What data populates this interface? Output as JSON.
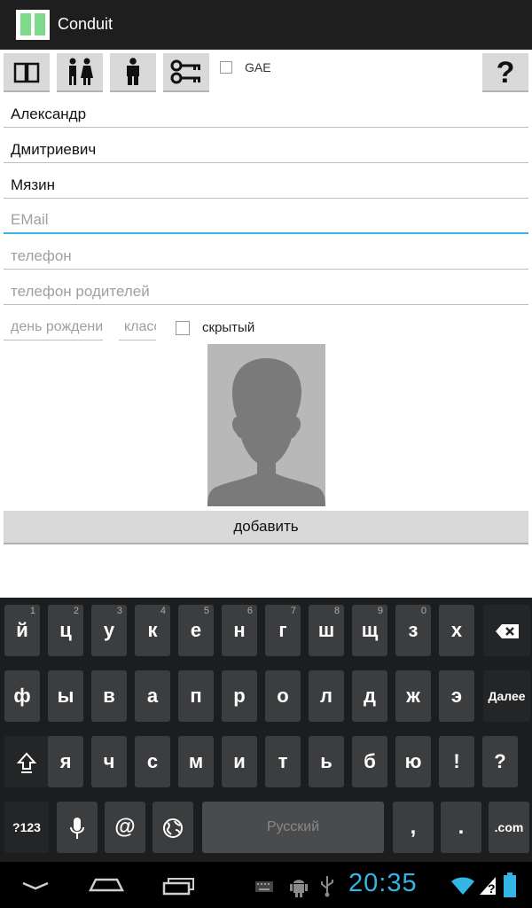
{
  "app": {
    "title": "Conduit"
  },
  "toolbar": {
    "gae_label": "GAE",
    "help_label": "?"
  },
  "form": {
    "first_name": "Александр",
    "middle_name": "Дмитриевич",
    "last_name": "Мязин",
    "email_placeholder": "EMail",
    "phone_placeholder": "телефон",
    "parent_phone_placeholder": "телефон родителей",
    "birthday_placeholder": "день рождения",
    "class_placeholder": "класс",
    "hidden_label": "скрытый",
    "add_button": "добавить"
  },
  "keyboard": {
    "row1": [
      {
        "label": "й",
        "hint": "1"
      },
      {
        "label": "ц",
        "hint": "2"
      },
      {
        "label": "у",
        "hint": "3"
      },
      {
        "label": "к",
        "hint": "4"
      },
      {
        "label": "е",
        "hint": "5"
      },
      {
        "label": "н",
        "hint": "6"
      },
      {
        "label": "г",
        "hint": "7"
      },
      {
        "label": "ш",
        "hint": "8"
      },
      {
        "label": "щ",
        "hint": "9"
      },
      {
        "label": "з",
        "hint": "0"
      },
      {
        "label": "х",
        "hint": ""
      }
    ],
    "row2": [
      "ф",
      "ы",
      "в",
      "а",
      "п",
      "р",
      "о",
      "л",
      "д",
      "ж",
      "э"
    ],
    "row3": [
      "я",
      "ч",
      "с",
      "м",
      "и",
      "т",
      "ь",
      "б",
      "ю",
      "!",
      "?"
    ],
    "next_label": "Далее",
    "symbols_label": "?123",
    "at_label": "@",
    "space_label": "Русский",
    "comma_label": ",",
    "period_label": ".",
    "com_label": ".com"
  },
  "status": {
    "time": "20:35"
  },
  "icons": [
    "book-icon",
    "people-icon",
    "person-icon",
    "keys-icon",
    "backspace-icon",
    "shift-icon",
    "mic-icon",
    "globe-icon",
    "back-icon",
    "home-icon",
    "recent-apps-icon",
    "keyboard-icon",
    "android-debug-icon",
    "usb-icon",
    "wifi-icon",
    "signal-icon",
    "battery-icon"
  ],
  "colors": {
    "accent": "#33b5e5",
    "titlebar": "#1e1e1e",
    "keyboard_bg": "#1c1d1f"
  }
}
